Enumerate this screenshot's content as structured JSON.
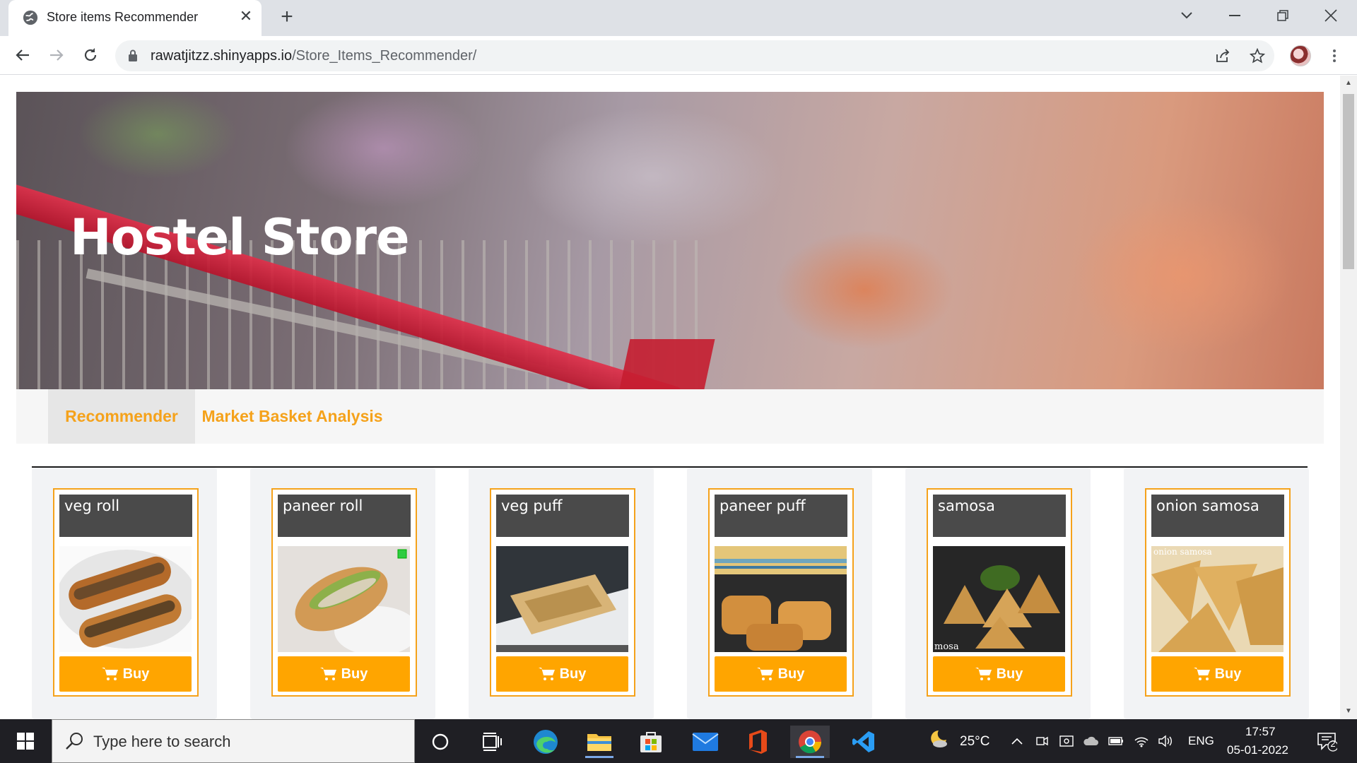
{
  "browser": {
    "tab_title": "Store items Recommender",
    "url_host": "rawatjitzz.shinyapps.io",
    "url_path": "/Store_Items_Recommender/"
  },
  "page": {
    "hero_title": "Hostel Store",
    "tabs": [
      {
        "label": "Recommender",
        "active": true
      },
      {
        "label": "Market Basket Analysis",
        "active": false
      }
    ],
    "products": [
      {
        "name": "veg roll",
        "buy_label": "Buy",
        "image": "veg-roll-photo"
      },
      {
        "name": "paneer roll",
        "buy_label": "Buy",
        "image": "paneer-roll-photo"
      },
      {
        "name": "veg puff",
        "buy_label": "Buy",
        "image": "veg-puff-photo"
      },
      {
        "name": "paneer puff",
        "buy_label": "Buy",
        "image": "paneer-puff-photo"
      },
      {
        "name": "samosa",
        "buy_label": "Buy",
        "image": "samosa-photo",
        "image_caption": "mosa"
      },
      {
        "name": "onion samosa",
        "buy_label": "Buy",
        "image": "onion-samosa-photo",
        "image_caption": "onion samosa"
      }
    ],
    "colors": {
      "accent": "#f5a21b",
      "buy_button": "#ffa500",
      "card_title_bg": "#4a4a4a"
    }
  },
  "taskbar": {
    "search_placeholder": "Type here to search",
    "weather": "25°C",
    "language": "ENG",
    "time": "17:57",
    "date": "05-01-2022",
    "notification_count": "2"
  }
}
